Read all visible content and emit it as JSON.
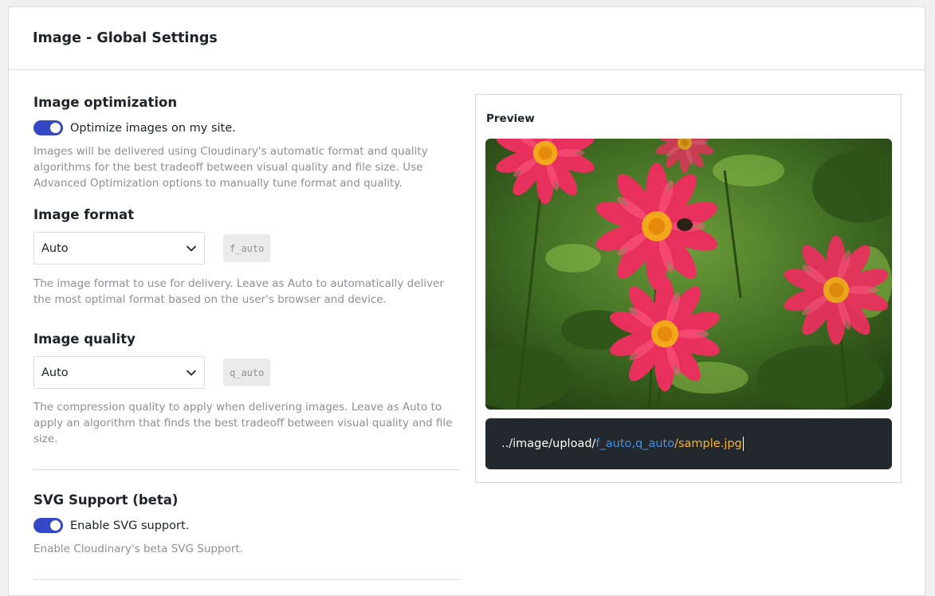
{
  "header": {
    "title": "Image - Global Settings"
  },
  "optimization": {
    "title": "Image optimization",
    "toggle_on": true,
    "toggle_label": "Optimize images on my site.",
    "description": "Images will be delivered using Cloudinary's automatic format and quality algorithms for the best tradeoff between visual quality and file size. Use Advanced Optimization options to manually tune format and quality."
  },
  "format": {
    "title": "Image format",
    "selected": "Auto",
    "code": "f_auto",
    "description": "The image format to use for delivery. Leave as Auto to automatically deliver the most optimal format based on the user's browser and device."
  },
  "quality": {
    "title": "Image quality",
    "selected": "Auto",
    "code": "q_auto",
    "description": "The compression quality to apply when delivering images. Leave as Auto to apply an algorithm that finds the best tradeoff between visual quality and file size."
  },
  "svg": {
    "title": "SVG Support (beta)",
    "toggle_on": true,
    "toggle_label": "Enable SVG support.",
    "description": "Enable Cloudinary's beta SVG Support."
  },
  "preview": {
    "label": "Preview",
    "url_base": "../image/upload/",
    "url_transform": "f_auto,q_auto",
    "url_file": "/sample.jpg"
  },
  "colors": {
    "accent": "#3448c5",
    "url_bar_bg": "#23282d",
    "url_transform": "#4a90e2",
    "url_file": "#f5b433"
  }
}
